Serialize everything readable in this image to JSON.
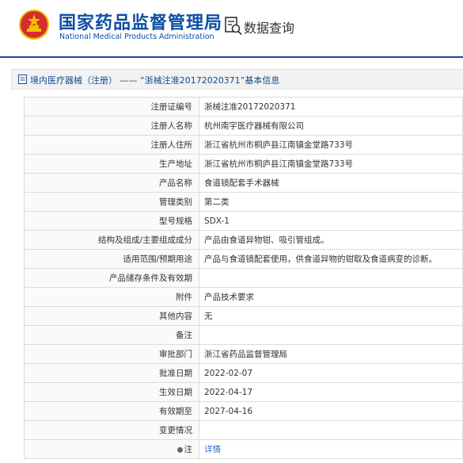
{
  "header": {
    "logo_cn": "国家药品监督管理局",
    "logo_en": "National Medical Products Administration",
    "section_title": "数据查询"
  },
  "breadcrumb": {
    "link_label": "境内医疗器械（注册）",
    "separator": "——",
    "title": "“浙械注准20172020371”基本信息"
  },
  "record": {
    "rows": [
      {
        "label": "注册证编号",
        "value": "浙械注准20172020371"
      },
      {
        "label": "注册人名称",
        "value": "杭州南宇医疗器械有限公司"
      },
      {
        "label": "注册人住所",
        "value": "浙江省杭州市桐庐县江南镇金堂路733号"
      },
      {
        "label": "生产地址",
        "value": "浙江省杭州市桐庐县江南镇金堂路733号"
      },
      {
        "label": "产品名称",
        "value": "食道镜配套手术器械"
      },
      {
        "label": "管理类别",
        "value": "第二类"
      },
      {
        "label": "型号规格",
        "value": "SDX-1"
      },
      {
        "label": "结构及组成/主要组成成分",
        "value": "产品由食道异物钳、吸引管组成。"
      },
      {
        "label": "适用范围/预期用途",
        "value": "产品与食道镜配套使用，供食道异物的钳取及食道病变的诊断。"
      },
      {
        "label": "产品储存条件及有效期",
        "value": ""
      },
      {
        "label": "附件",
        "value": "产品技术要求"
      },
      {
        "label": "其他内容",
        "value": "无"
      },
      {
        "label": "备注",
        "value": ""
      },
      {
        "label": "审批部门",
        "value": "浙江省药品监督管理局"
      },
      {
        "label": "批准日期",
        "value": "2022-02-07"
      },
      {
        "label": "生效日期",
        "value": "2022-04-17"
      },
      {
        "label": "有效期至",
        "value": "2027-04-16"
      },
      {
        "label": "变更情况",
        "value": ""
      }
    ],
    "note_label": "注",
    "note_link": "详情"
  },
  "colors": {
    "brand_blue": "#0d4ea5",
    "emblem_red": "#d32f2f",
    "emblem_gold": "#f2c100"
  },
  "icons": [
    "national-emblem-icon",
    "data-query-icon",
    "document-icon",
    "bullet-dot-icon"
  ]
}
